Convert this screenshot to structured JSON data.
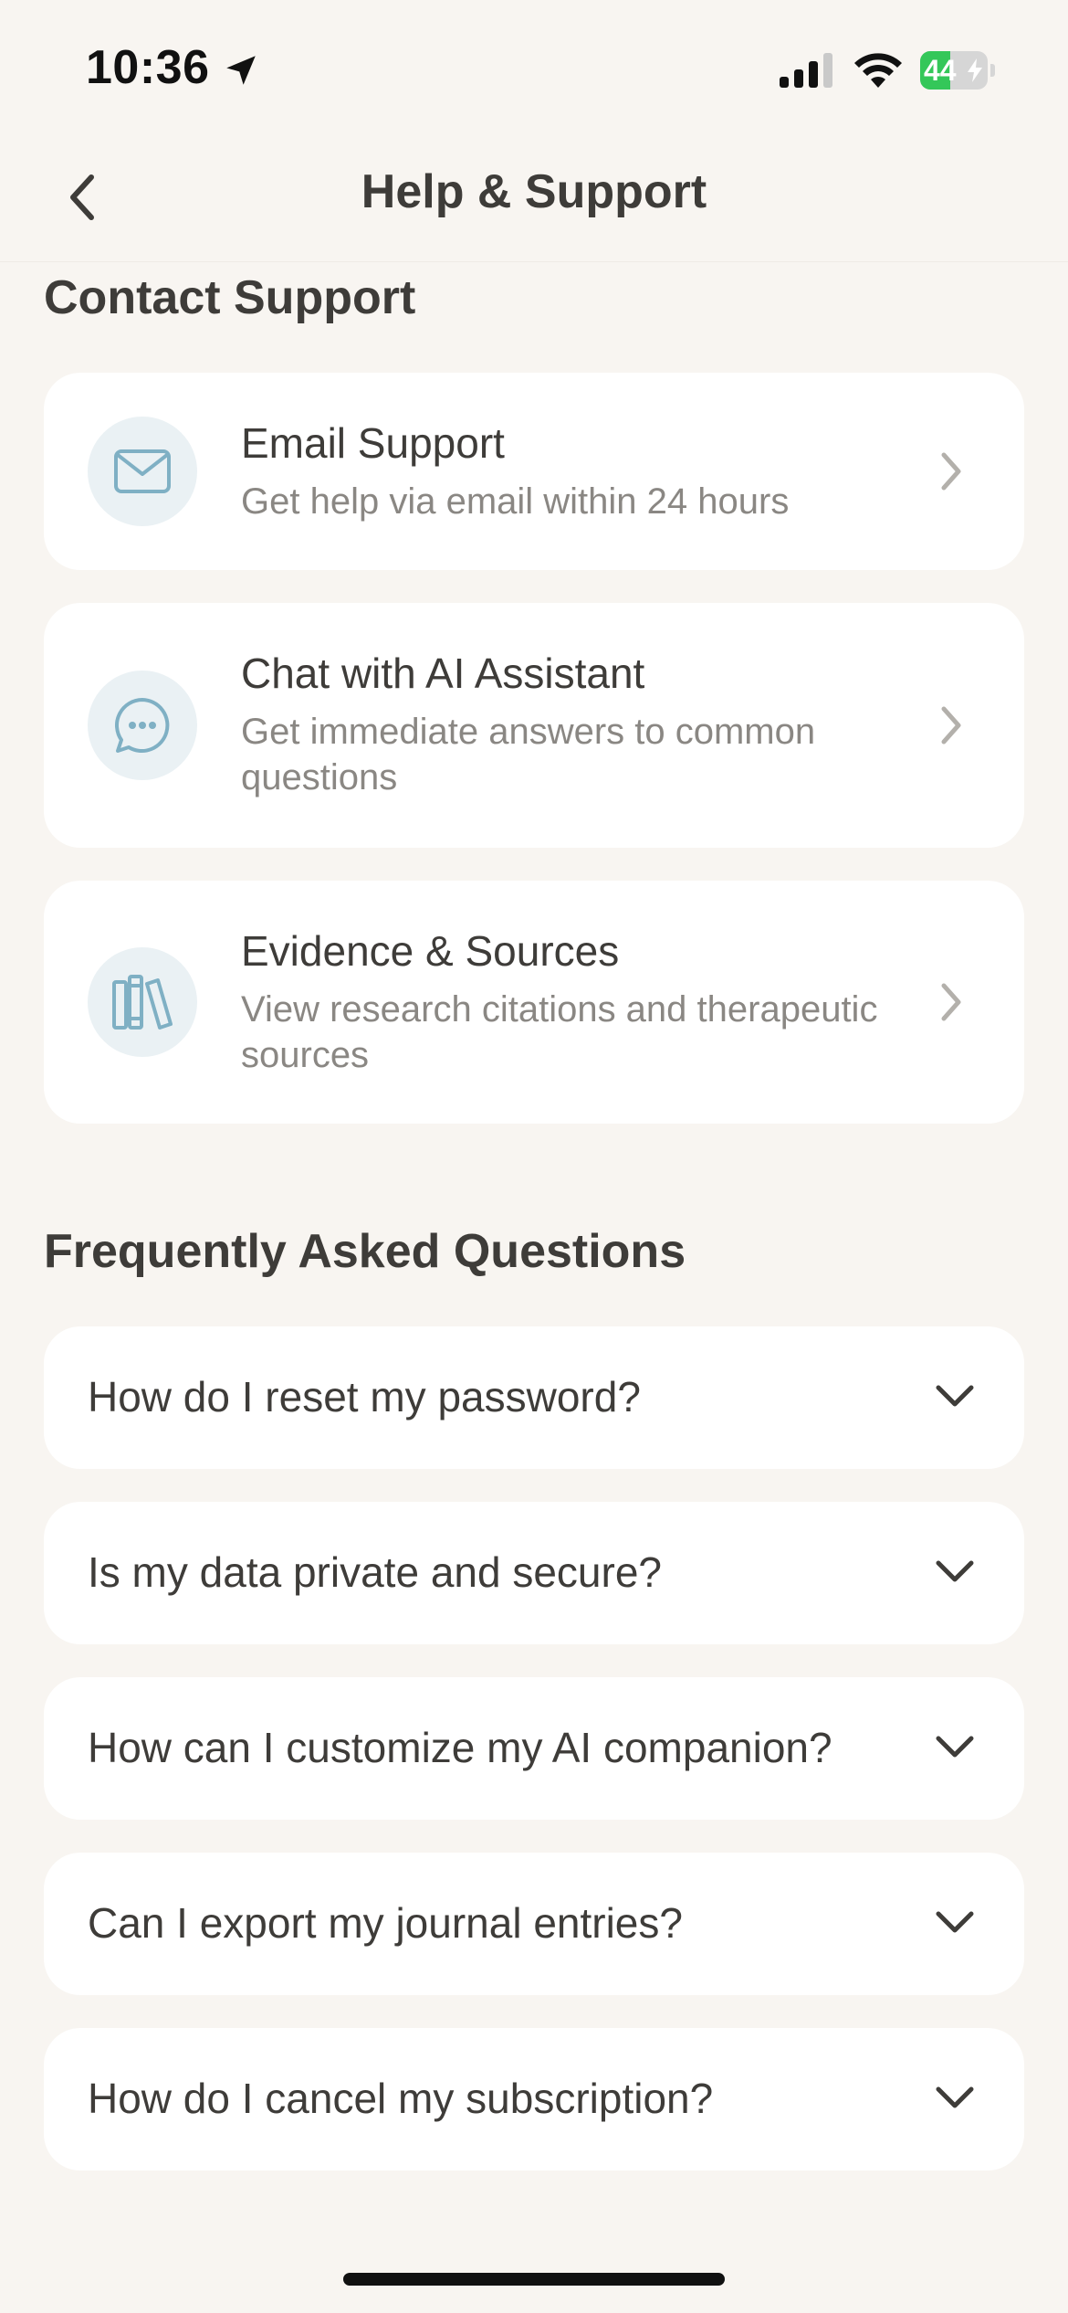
{
  "status_bar": {
    "time": "10:36",
    "battery_level": "44",
    "battery_fraction": 0.44
  },
  "nav": {
    "title": "Help & Support"
  },
  "contact_section": {
    "title": "Contact Support",
    "items": [
      {
        "title": "Email Support",
        "subtitle": "Get help via email within 24 hours",
        "icon": "envelope-icon"
      },
      {
        "title": "Chat with AI Assistant",
        "subtitle": "Get immediate answers to common questions",
        "icon": "chat-bubble-icon"
      },
      {
        "title": "Evidence & Sources",
        "subtitle": "View research citations and therapeutic sources",
        "icon": "books-icon"
      }
    ]
  },
  "faq_section": {
    "title": "Frequently Asked Questions",
    "items": [
      {
        "question": "How do I reset my password?"
      },
      {
        "question": "Is my data private and secure?"
      },
      {
        "question": "How can I customize my AI companion?"
      },
      {
        "question": "Can I export my journal entries?"
      },
      {
        "question": "How do I cancel my subscription?"
      }
    ]
  },
  "colors": {
    "background": "#f8f5f1",
    "card": "#ffffff",
    "icon_tint": "#7fb0c4",
    "icon_circle": "#eaf1f4",
    "primary_text": "#3e3c39",
    "secondary_text": "#8a8783",
    "battery": "#34c759"
  }
}
